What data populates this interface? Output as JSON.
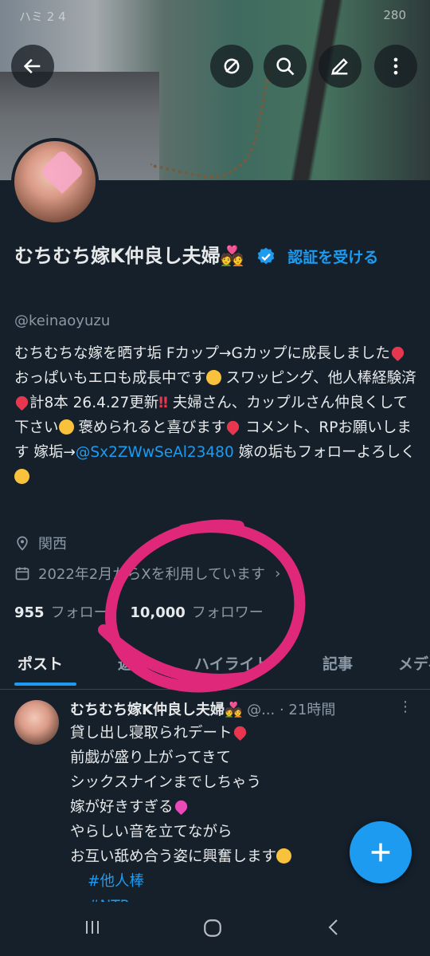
{
  "status": {
    "left": "ハミ 2 4",
    "right": "280"
  },
  "header": {
    "back_icon": "arrow-left-icon",
    "actions": [
      "refresh-icon",
      "search-icon",
      "edit-icon",
      "more-vertical-icon"
    ]
  },
  "profile": {
    "name": "むちむち嫁K仲良し夫婦💑",
    "verify_label": "認証を受ける",
    "handle": "@keinaoyuzu",
    "bio_parts": {
      "p1": "むちむちな嫁を晒す垢 Fカップ→Gカップに成長しました",
      "p2": " おっぱいもエロも成長中です",
      "p3": " スワッピング、他人棒経験済",
      "p4": "計8本 26.4.27更新",
      "p5": " 夫婦さん、カップルさん仲良くして下さい",
      "p6": " 褒められると喜びます",
      "p7": " コメント、RPお願いします 嫁垢→",
      "mention": "@Sx2ZWwSeAl23480",
      "p8": " 嫁の垢もフォローよろしく"
    },
    "location": "関西",
    "joined": "2022年2月からXを利用しています",
    "following_count": "955",
    "following_label": "フォロー",
    "followers_count": "10,000",
    "followers_label": "フォロワー"
  },
  "tabs": [
    "ポスト",
    "返信",
    "ハイライト",
    "記事",
    "メディア"
  ],
  "post": {
    "name": "むちむち嫁K仲良し夫婦💑",
    "meta": "@... · 21時間",
    "lines": [
      "貸し出し寝取られデート",
      "前戯が盛り上がってきて",
      "シックスナインまでしちゃう",
      "嫁が好きすぎる",
      "やらしい音を立てながら",
      "お互い舐め合う姿に興奮します"
    ],
    "tags": [
      "#他人棒",
      "#NTR"
    ]
  },
  "colors": {
    "accent": "#1d9bf0",
    "background": "#15202b",
    "annotation": "#e0287a"
  }
}
